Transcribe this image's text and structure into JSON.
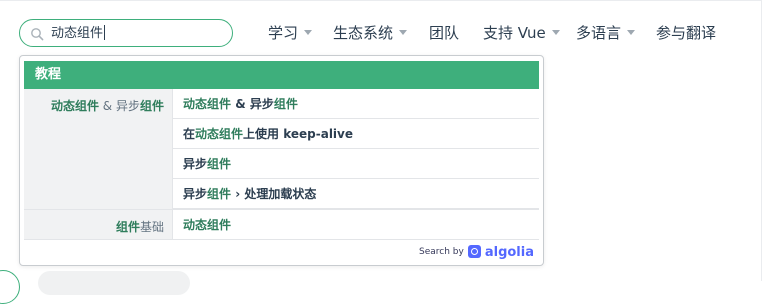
{
  "search": {
    "value": "动态组件"
  },
  "nav": [
    {
      "label": "学习",
      "dropdown": true
    },
    {
      "label": "生态系统",
      "dropdown": true
    },
    {
      "label": "团队",
      "dropdown": false
    },
    {
      "label": "支持 Vue",
      "dropdown": true
    },
    {
      "label": "多语言",
      "dropdown": true
    },
    {
      "label": "参与翻译",
      "dropdown": false
    }
  ],
  "results": {
    "category": "教程",
    "groups": [
      {
        "lvl1": {
          "hl1": "动态组件",
          "mid": " & 异步",
          "hl2": "组件"
        },
        "items": [
          {
            "pre": "",
            "hl": "动态组件",
            "mid": " & 异步",
            "hl2": "组件",
            "post": ""
          },
          {
            "pre": "在",
            "hl": "动态组件",
            "mid": "上使用 keep-alive",
            "hl2": "",
            "post": ""
          },
          {
            "pre": "异步",
            "hl": "组件",
            "mid": "",
            "hl2": "",
            "post": ""
          },
          {
            "pre": "异步",
            "hl": "组件",
            "mid": " › 处理加载状态",
            "hl2": "",
            "post": ""
          }
        ]
      },
      {
        "lvl1": {
          "hl1": "组件",
          "mid": "基础",
          "hl2": ""
        },
        "items": [
          {
            "pre": "",
            "hl": "动态组件",
            "mid": "",
            "hl2": "",
            "post": ""
          }
        ]
      }
    ]
  },
  "footer": {
    "search_by": "Search by",
    "brand": "algolia"
  },
  "colors": {
    "accent": "#3eaf7c",
    "highlight": "#2f7d5c",
    "algolia": "#5468ff"
  }
}
